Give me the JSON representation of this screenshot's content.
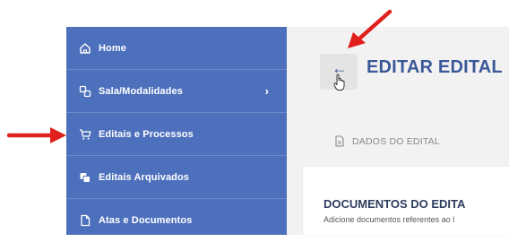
{
  "sidebar": {
    "items": [
      {
        "label": "Home",
        "icon": "home-icon"
      },
      {
        "label": "Sala/Modalidades",
        "icon": "rooms-icon",
        "has_chevron": true
      },
      {
        "label": "Editais e Processos",
        "icon": "cart-icon"
      },
      {
        "label": "Editais Arquivados",
        "icon": "archive-icon"
      },
      {
        "label": "Atas e Documentos",
        "icon": "document-icon"
      }
    ],
    "chevron": "›"
  },
  "header": {
    "back_icon": "←",
    "title": "EDITAR EDITAL"
  },
  "tabs": [
    {
      "label": "DADOS DO EDITAL",
      "icon": "file-icon"
    }
  ],
  "documents_card": {
    "title": "DOCUMENTOS DO EDITA",
    "description": "Adicione documentos referentes ao l"
  },
  "colors": {
    "sidebar_bg": "#4d70bd",
    "title_blue": "#3b5998",
    "content_bg": "#f2f2f2",
    "annotation_red": "#e0201c"
  }
}
